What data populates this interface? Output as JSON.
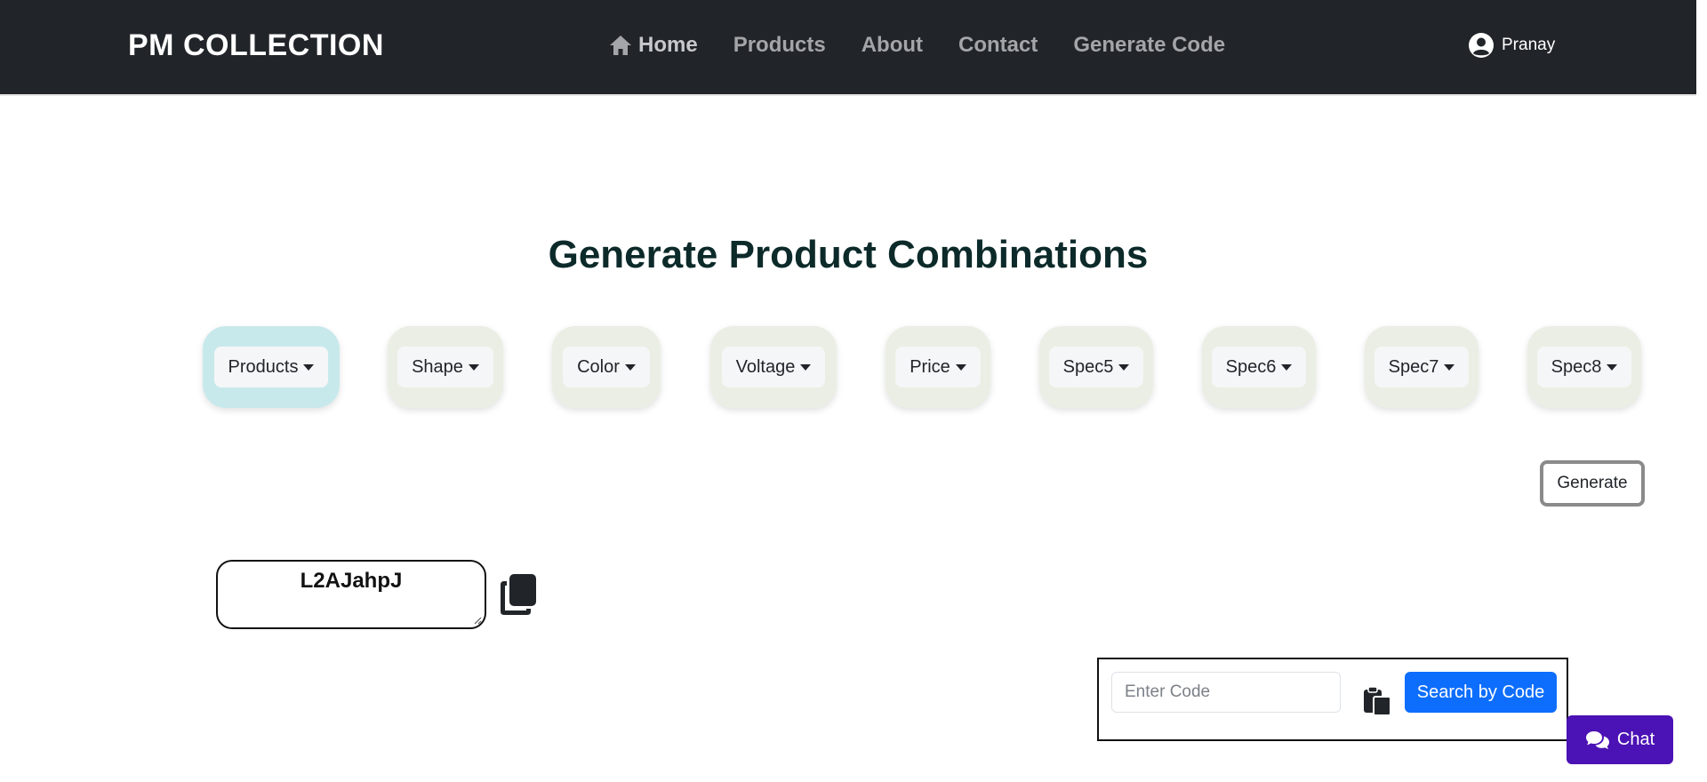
{
  "nav": {
    "brand": "PM COLLECTION",
    "links": [
      {
        "label": "Home",
        "icon": "home-icon"
      },
      {
        "label": "Products"
      },
      {
        "label": "About"
      },
      {
        "label": "Contact"
      },
      {
        "label": "Generate Code"
      }
    ],
    "user": {
      "name": "Pranay",
      "icon": "user-circle-icon"
    }
  },
  "main": {
    "title": "Generate Product Combinations",
    "filters": [
      {
        "label": "Products",
        "active": true
      },
      {
        "label": "Shape"
      },
      {
        "label": "Color"
      },
      {
        "label": "Voltage"
      },
      {
        "label": "Price"
      },
      {
        "label": "Spec5"
      },
      {
        "label": "Spec6"
      },
      {
        "label": "Spec7"
      },
      {
        "label": "Spec8"
      }
    ],
    "generate_label": "Generate",
    "generated_code": "L2AJahpJ"
  },
  "search": {
    "placeholder": "Enter Code",
    "value": "",
    "button_label": "Search by Code"
  },
  "chat": {
    "label": "Chat"
  },
  "colors": {
    "navbar": "#212529",
    "primary": "#0d6efd",
    "chat": "#4b12b5",
    "pill": "#ebeee4",
    "pill_active": "#c8e9ec"
  }
}
